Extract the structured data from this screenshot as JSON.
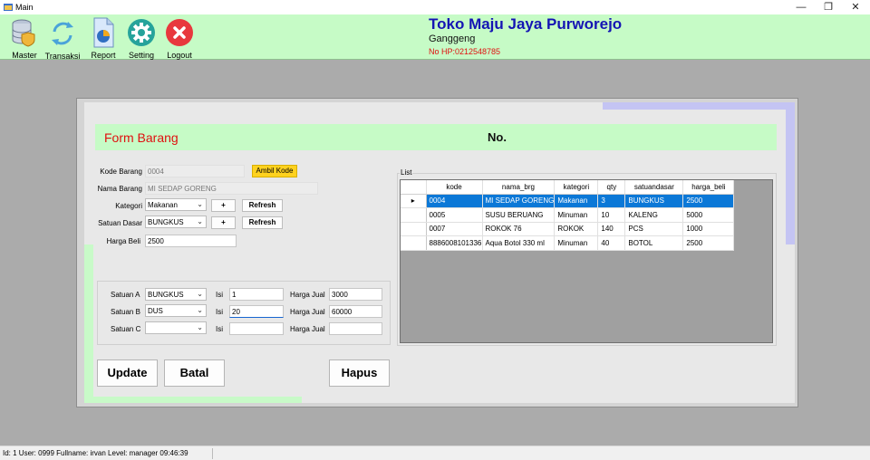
{
  "window": {
    "title": "Main",
    "minimize": "—",
    "restore": "❐",
    "close": "✕"
  },
  "toolbar": {
    "items": [
      {
        "label": "Master",
        "icon": "database-shield-icon"
      },
      {
        "label": "Transaksi",
        "icon": "refresh-cycle-icon"
      },
      {
        "label": "Report",
        "icon": "report-chart-icon"
      },
      {
        "label": "Setting",
        "icon": "gear-icon"
      },
      {
        "label": "Logout",
        "icon": "close-circle-icon"
      }
    ]
  },
  "shop": {
    "name": "Toko Maju Jaya Purworejo",
    "address": "Ganggeng",
    "phone": "No HP:0212548785"
  },
  "form": {
    "title": "Form Barang",
    "no_label": "No.",
    "kode_label": "Kode Barang",
    "kode_value": "0004",
    "ambil_kode": "Ambil Kode",
    "nama_label": "Nama Barang",
    "nama_value": "MI SEDAP GORENG",
    "kategori_label": "Kategori",
    "kategori_value": "Makanan",
    "satuan_dasar_label": "Satuan Dasar",
    "satuan_dasar_value": "BUNGKUS",
    "plus": "+",
    "refresh": "Refresh",
    "harga_beli_label": "Harga Beli",
    "harga_beli_value": "2500"
  },
  "satuan": {
    "isi_label": "Isi",
    "harga_jual_label": "Harga Jual",
    "rows": [
      {
        "label": "Satuan A",
        "unit": "BUNGKUS",
        "isi": "1",
        "harga_jual": "3000"
      },
      {
        "label": "Satuan B",
        "unit": "DUS",
        "isi": "20",
        "harga_jual": "60000"
      },
      {
        "label": "Satuan C",
        "unit": "",
        "isi": "",
        "harga_jual": ""
      }
    ]
  },
  "list": {
    "caption": "List",
    "columns": [
      "kode",
      "nama_brg",
      "kategori",
      "qty",
      "satuandasar",
      "harga_beli"
    ],
    "rows": [
      [
        "0004",
        "MI SEDAP GORENG",
        "Makanan",
        "3",
        "BUNGKUS",
        "2500"
      ],
      [
        "0005",
        "SUSU BERUANG",
        "Minuman",
        "10",
        "KALENG",
        "5000"
      ],
      [
        "0007",
        "ROKOK 76",
        "ROKOK",
        "140",
        "PCS",
        "1000"
      ],
      [
        "8886008101336",
        "Aqua Botol 330 ml",
        "Minuman",
        "40",
        "BOTOL",
        "2500"
      ]
    ],
    "selected_index": 0,
    "row_indicator": "▸"
  },
  "actions": {
    "update": "Update",
    "batal": "Batal",
    "hapus": "Hapus"
  },
  "status": {
    "text": "Id:  1  User:  0999  Fullname:  irvan  Level:  manager  09:46:39"
  },
  "colors": {
    "toolbar_bg": "#c6fbc6",
    "shop_name": "#1414b4",
    "phone": "#e01010",
    "form_title": "#e01010",
    "selection": "#0b78d7",
    "ambil_kode_bg": "#ffd21f"
  }
}
